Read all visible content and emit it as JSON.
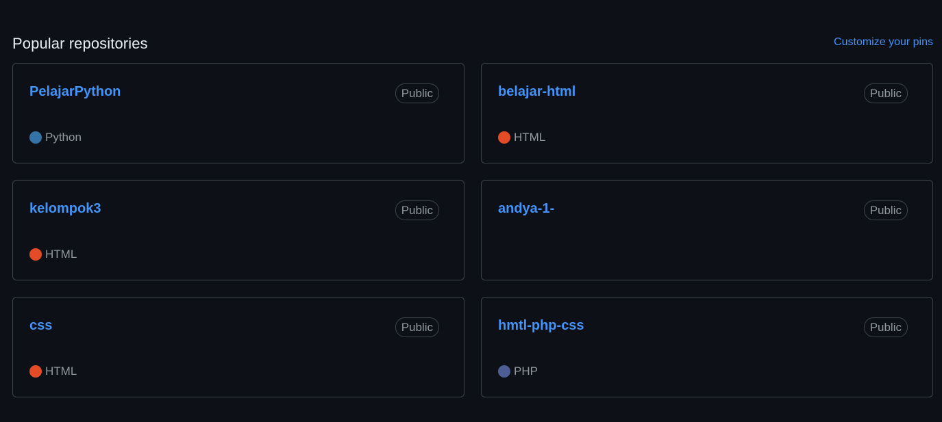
{
  "header": {
    "title": "Popular repositories",
    "customize_label": "Customize your pins"
  },
  "repos": [
    {
      "name": "PelajarPython",
      "visibility": "Public",
      "language": "Python",
      "language_color": "#3572A5"
    },
    {
      "name": "belajar-html",
      "visibility": "Public",
      "language": "HTML",
      "language_color": "#e34c26"
    },
    {
      "name": "kelompok3",
      "visibility": "Public",
      "language": "HTML",
      "language_color": "#e34c26"
    },
    {
      "name": "andya-1-",
      "visibility": "Public",
      "language": "",
      "language_color": ""
    },
    {
      "name": "css",
      "visibility": "Public",
      "language": "HTML",
      "language_color": "#e34c26"
    },
    {
      "name": "hmtl-php-css",
      "visibility": "Public",
      "language": "PHP",
      "language_color": "#4F5D95"
    }
  ]
}
